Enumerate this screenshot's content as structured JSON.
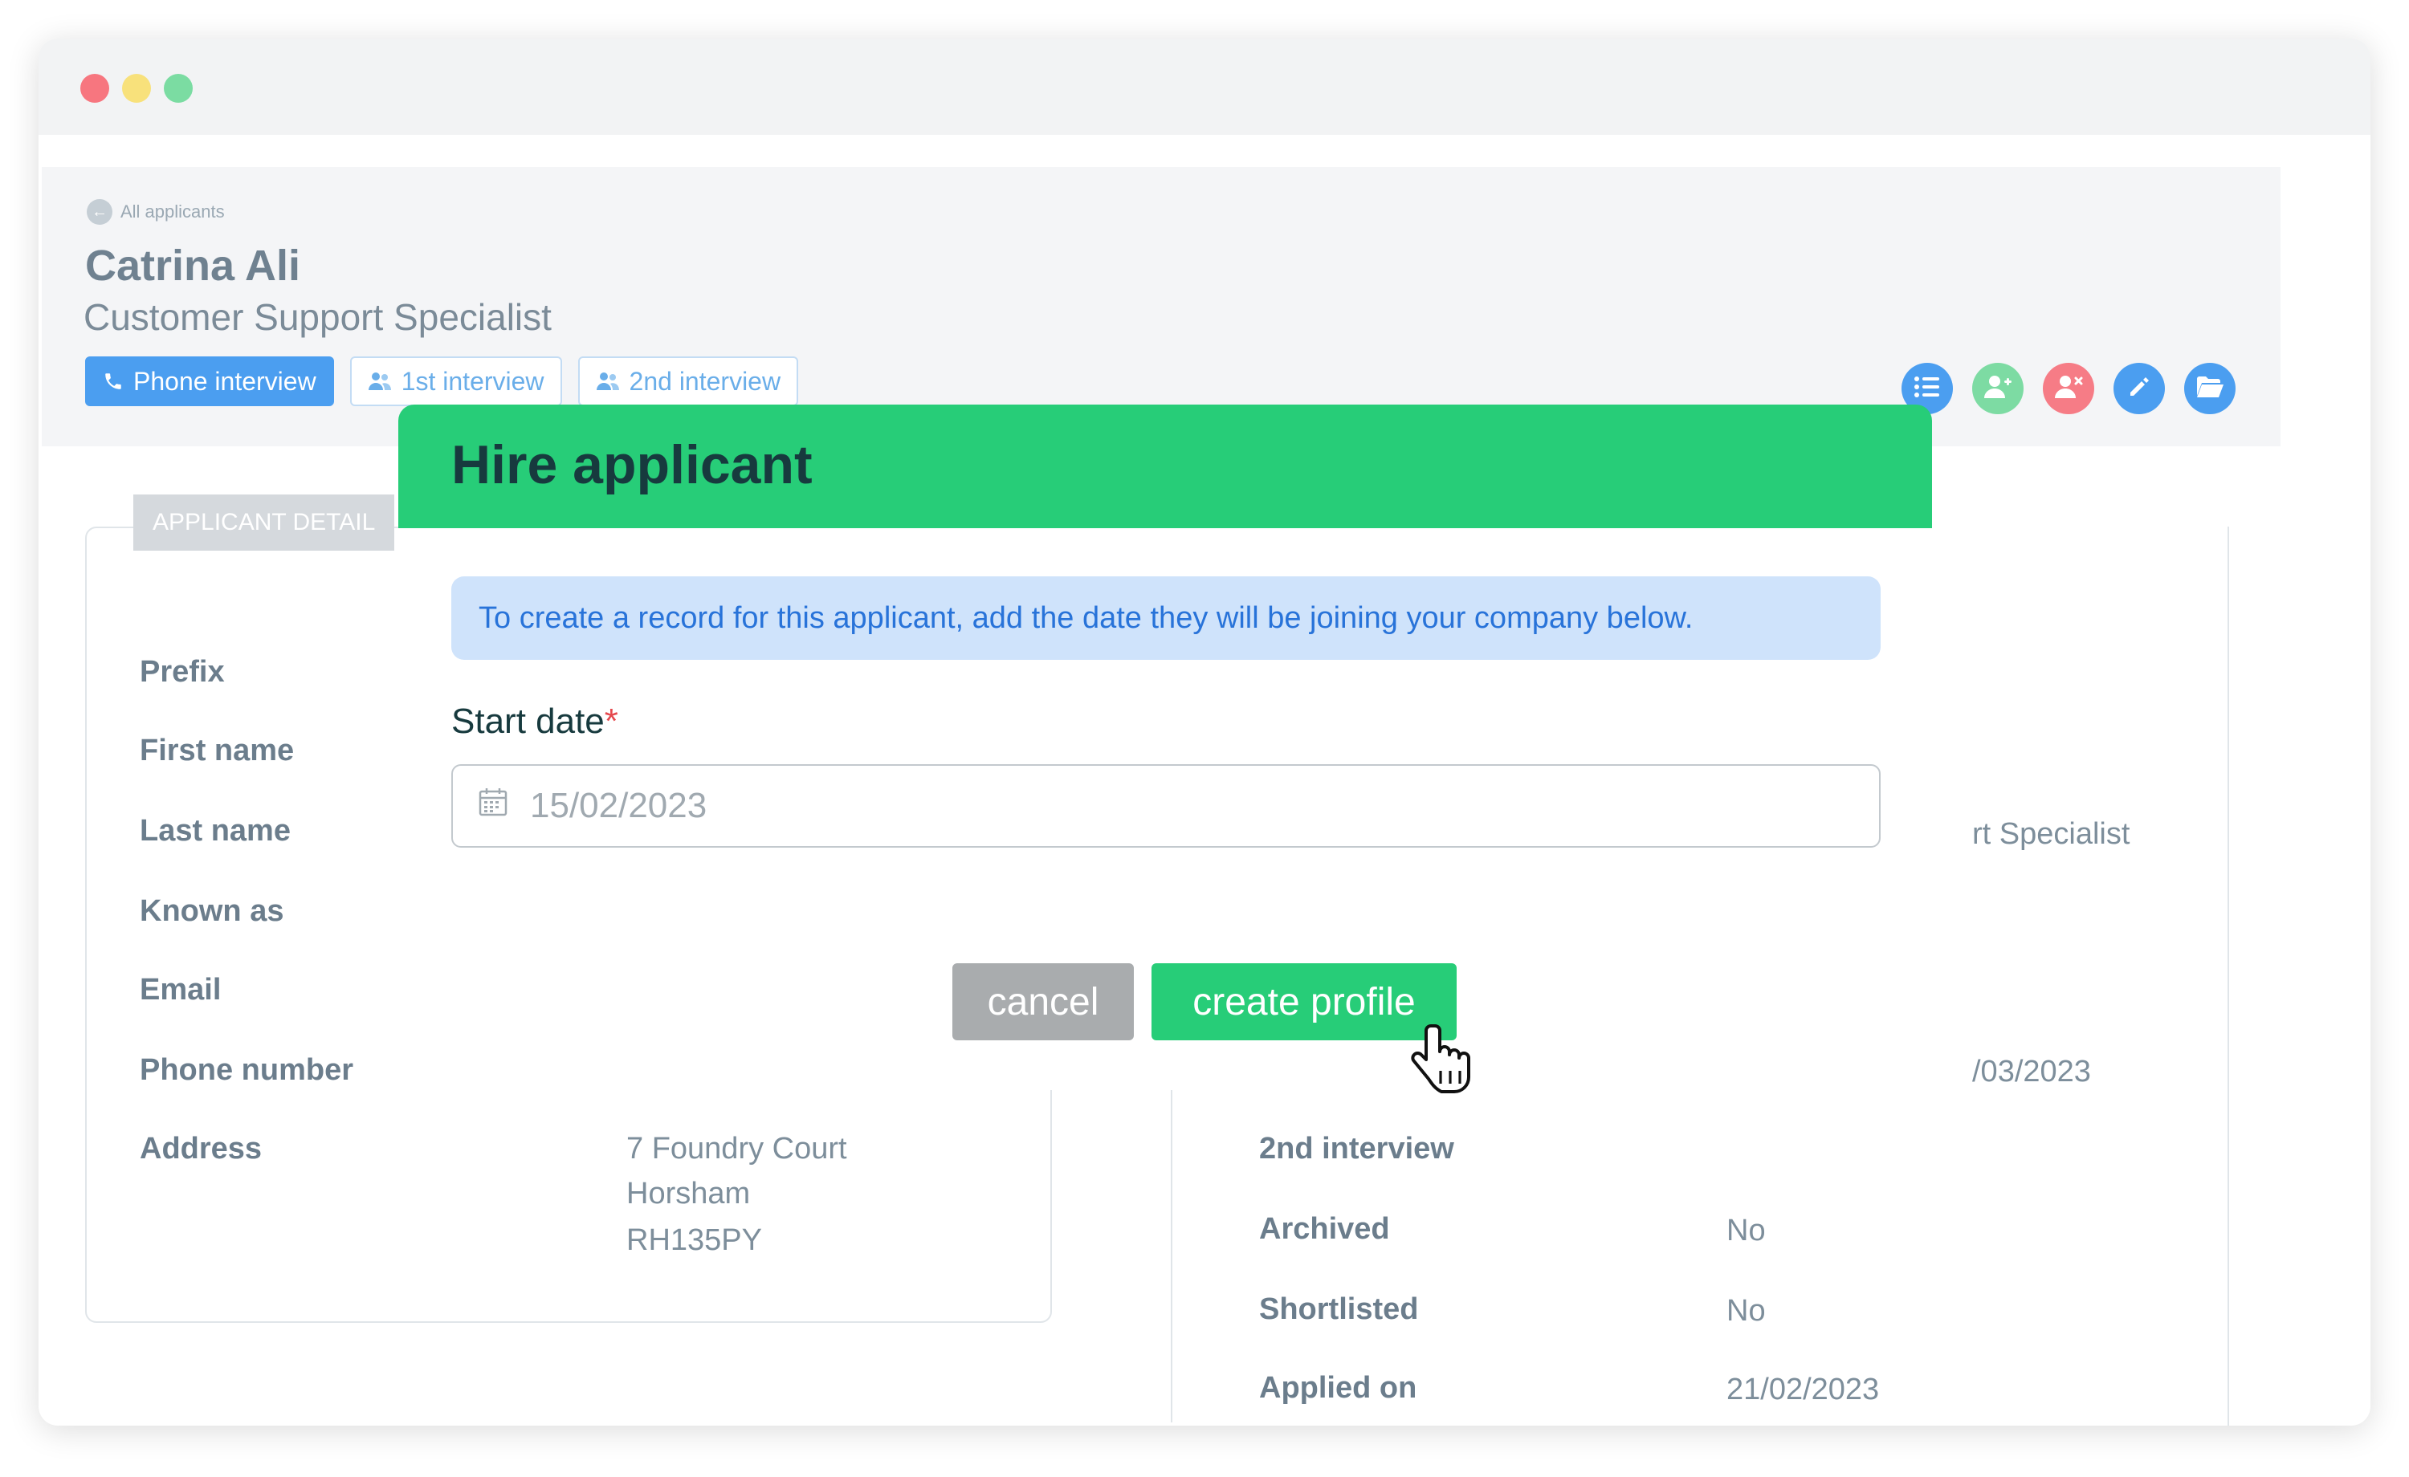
{
  "breadcrumb": {
    "label": "All applicants"
  },
  "applicant": {
    "name": "Catrina Ali",
    "role": "Customer Support Specialist"
  },
  "tabs": [
    {
      "label": "Phone interview",
      "icon": "phone-icon",
      "active": true
    },
    {
      "label": "1st interview",
      "icon": "users-icon",
      "active": false
    },
    {
      "label": "2nd interview",
      "icon": "users-icon",
      "active": false
    }
  ],
  "actions": [
    {
      "name": "list-icon",
      "color": "#4b9ef0"
    },
    {
      "name": "add-user-icon",
      "color": "#7ddba3"
    },
    {
      "name": "remove-user-icon",
      "color": "#f67c86"
    },
    {
      "name": "edit-icon",
      "color": "#4b9ef0"
    },
    {
      "name": "folder-icon",
      "color": "#4b9ef0"
    }
  ],
  "details": {
    "legend": "APPLICANT DETAIL",
    "labels": {
      "prefix": "Prefix",
      "first_name": "First name",
      "last_name": "Last name",
      "known_as": "Known as",
      "email": "Email",
      "phone": "Phone number",
      "address": "Address"
    },
    "address_lines": [
      "7 Foundry Court",
      "Horsham",
      "RH135PY"
    ],
    "right": {
      "role_partial": "rt Specialist",
      "date_partial": "/03/2023",
      "second_interview_label": "2nd interview",
      "archived_label": "Archived",
      "archived_value": "No",
      "shortlisted_label": "Shortlisted",
      "shortlisted_value": "No",
      "applied_label": "Applied on",
      "applied_value": "21/02/2023"
    }
  },
  "modal": {
    "title": "Hire applicant",
    "notice": "To create a record for this applicant, add the date they will be joining your company below.",
    "start_date_label": "Start date",
    "required_mark": "*",
    "start_date_value": "15/02/2023",
    "cancel_label": "cancel",
    "create_label": "create profile"
  },
  "colors": {
    "modal_header": "#27cd78",
    "primary_blue": "#4b9ef0",
    "notice_bg": "#cfe3fb"
  }
}
